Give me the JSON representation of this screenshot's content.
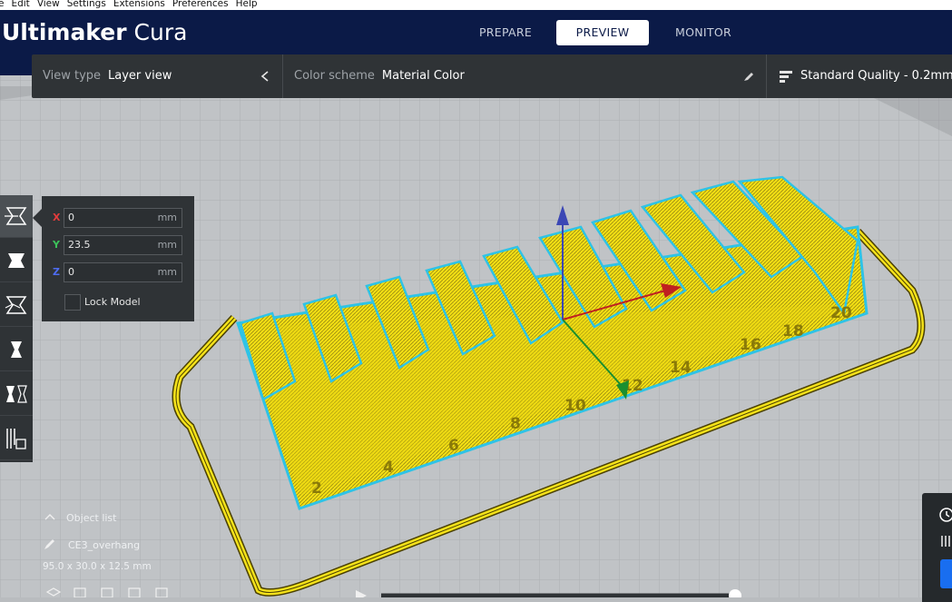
{
  "menu": [
    "e",
    "Edit",
    "View",
    "Settings",
    "Extensions",
    "Preferences",
    "Help"
  ],
  "app": {
    "brand": "Ultimaker",
    "product": "Cura"
  },
  "tabs": [
    {
      "label": "PREPARE",
      "active": false
    },
    {
      "label": "PREVIEW",
      "active": true
    },
    {
      "label": "MONITOR",
      "active": false
    }
  ],
  "toolbar": {
    "view_type_label": "View type",
    "view_type_value": "Layer view",
    "color_scheme_label": "Color scheme",
    "color_scheme_value": "Material Color",
    "quality": "Standard Quality - 0.2mm"
  },
  "move_panel": {
    "x_axis": "X",
    "x_value": "0",
    "y_axis": "Y",
    "y_value": "23.5",
    "z_axis": "Z",
    "z_value": "0",
    "unit": "mm",
    "lock_label": "Lock Model",
    "lock_checked": false
  },
  "object_info": {
    "list_label": "Object list",
    "name": "CE3_overhang",
    "dimensions": "95.0 x 30.0 x 12.5 mm"
  },
  "model_labels": [
    "2",
    "4",
    "6",
    "8",
    "10",
    "12",
    "14",
    "16",
    "18",
    "20"
  ],
  "left_tools": [
    "move-tool-icon",
    "scale-tool-icon",
    "rotate-tool-icon",
    "mirror-tool-icon",
    "per-model-settings-icon",
    "support-blocker-icon"
  ],
  "colors": {
    "header": "#0b1a47",
    "filament": "#f5e21a",
    "outline": "#2ec3e6",
    "panel": "#2f3336"
  }
}
